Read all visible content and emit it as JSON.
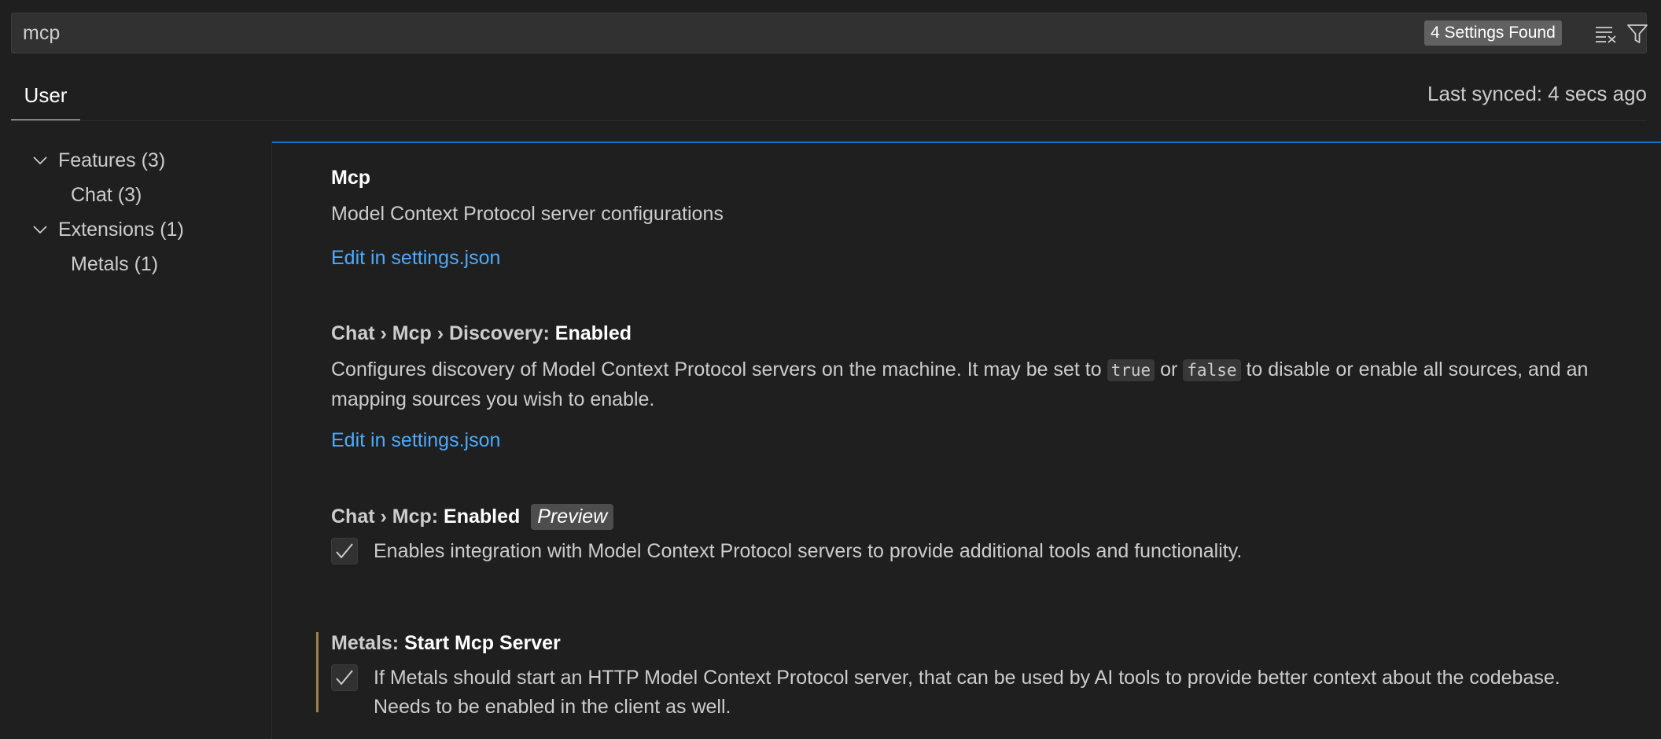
{
  "search": {
    "value": "mcp",
    "results_badge": "4 Settings Found",
    "clear_icon": "clear-filter-icon",
    "filter_icon": "filter-icon"
  },
  "tabs": {
    "user_label": "User",
    "last_synced": "Last synced: 4 secs ago"
  },
  "toc": {
    "items": [
      {
        "label": "Features (3)",
        "level": 0,
        "expanded": true
      },
      {
        "label": "Chat (3)",
        "level": 1
      },
      {
        "label": "Extensions (1)",
        "level": 0,
        "expanded": true
      },
      {
        "label": "Metals (1)",
        "level": 1
      }
    ]
  },
  "settings": [
    {
      "title_prefix": "",
      "title_leaf": "Mcp",
      "description": "Model Context Protocol server configurations",
      "link": "Edit in settings.json"
    },
    {
      "title_prefix": "Chat › Mcp › Discovery: ",
      "title_leaf": "Enabled",
      "description_part1": "Configures discovery of Model Context Protocol servers on the machine. It may be set to ",
      "code_true": "true",
      "description_part2": " or ",
      "code_false": "false",
      "description_part3": " to disable or enable all sources, and an mapping sources you wish to enable.",
      "link": "Edit in settings.json"
    },
    {
      "title_prefix": "Chat › Mcp: ",
      "title_leaf": "Enabled",
      "tag": "Preview",
      "checked": true,
      "description": "Enables integration with Model Context Protocol servers to provide additional tools and functionality."
    },
    {
      "title_prefix": "Metals: ",
      "title_leaf": "Start Mcp Server",
      "checked": true,
      "modified": true,
      "description": "If Metals should start an HTTP Model Context Protocol server, that can be used by AI tools to provide better context about the codebase. Needs to be enabled in the client as well."
    }
  ],
  "colors": {
    "background": "#1f1f1f",
    "accent": "#0078d4",
    "link": "#4daafc",
    "modified_indicator": "#a1824e"
  }
}
